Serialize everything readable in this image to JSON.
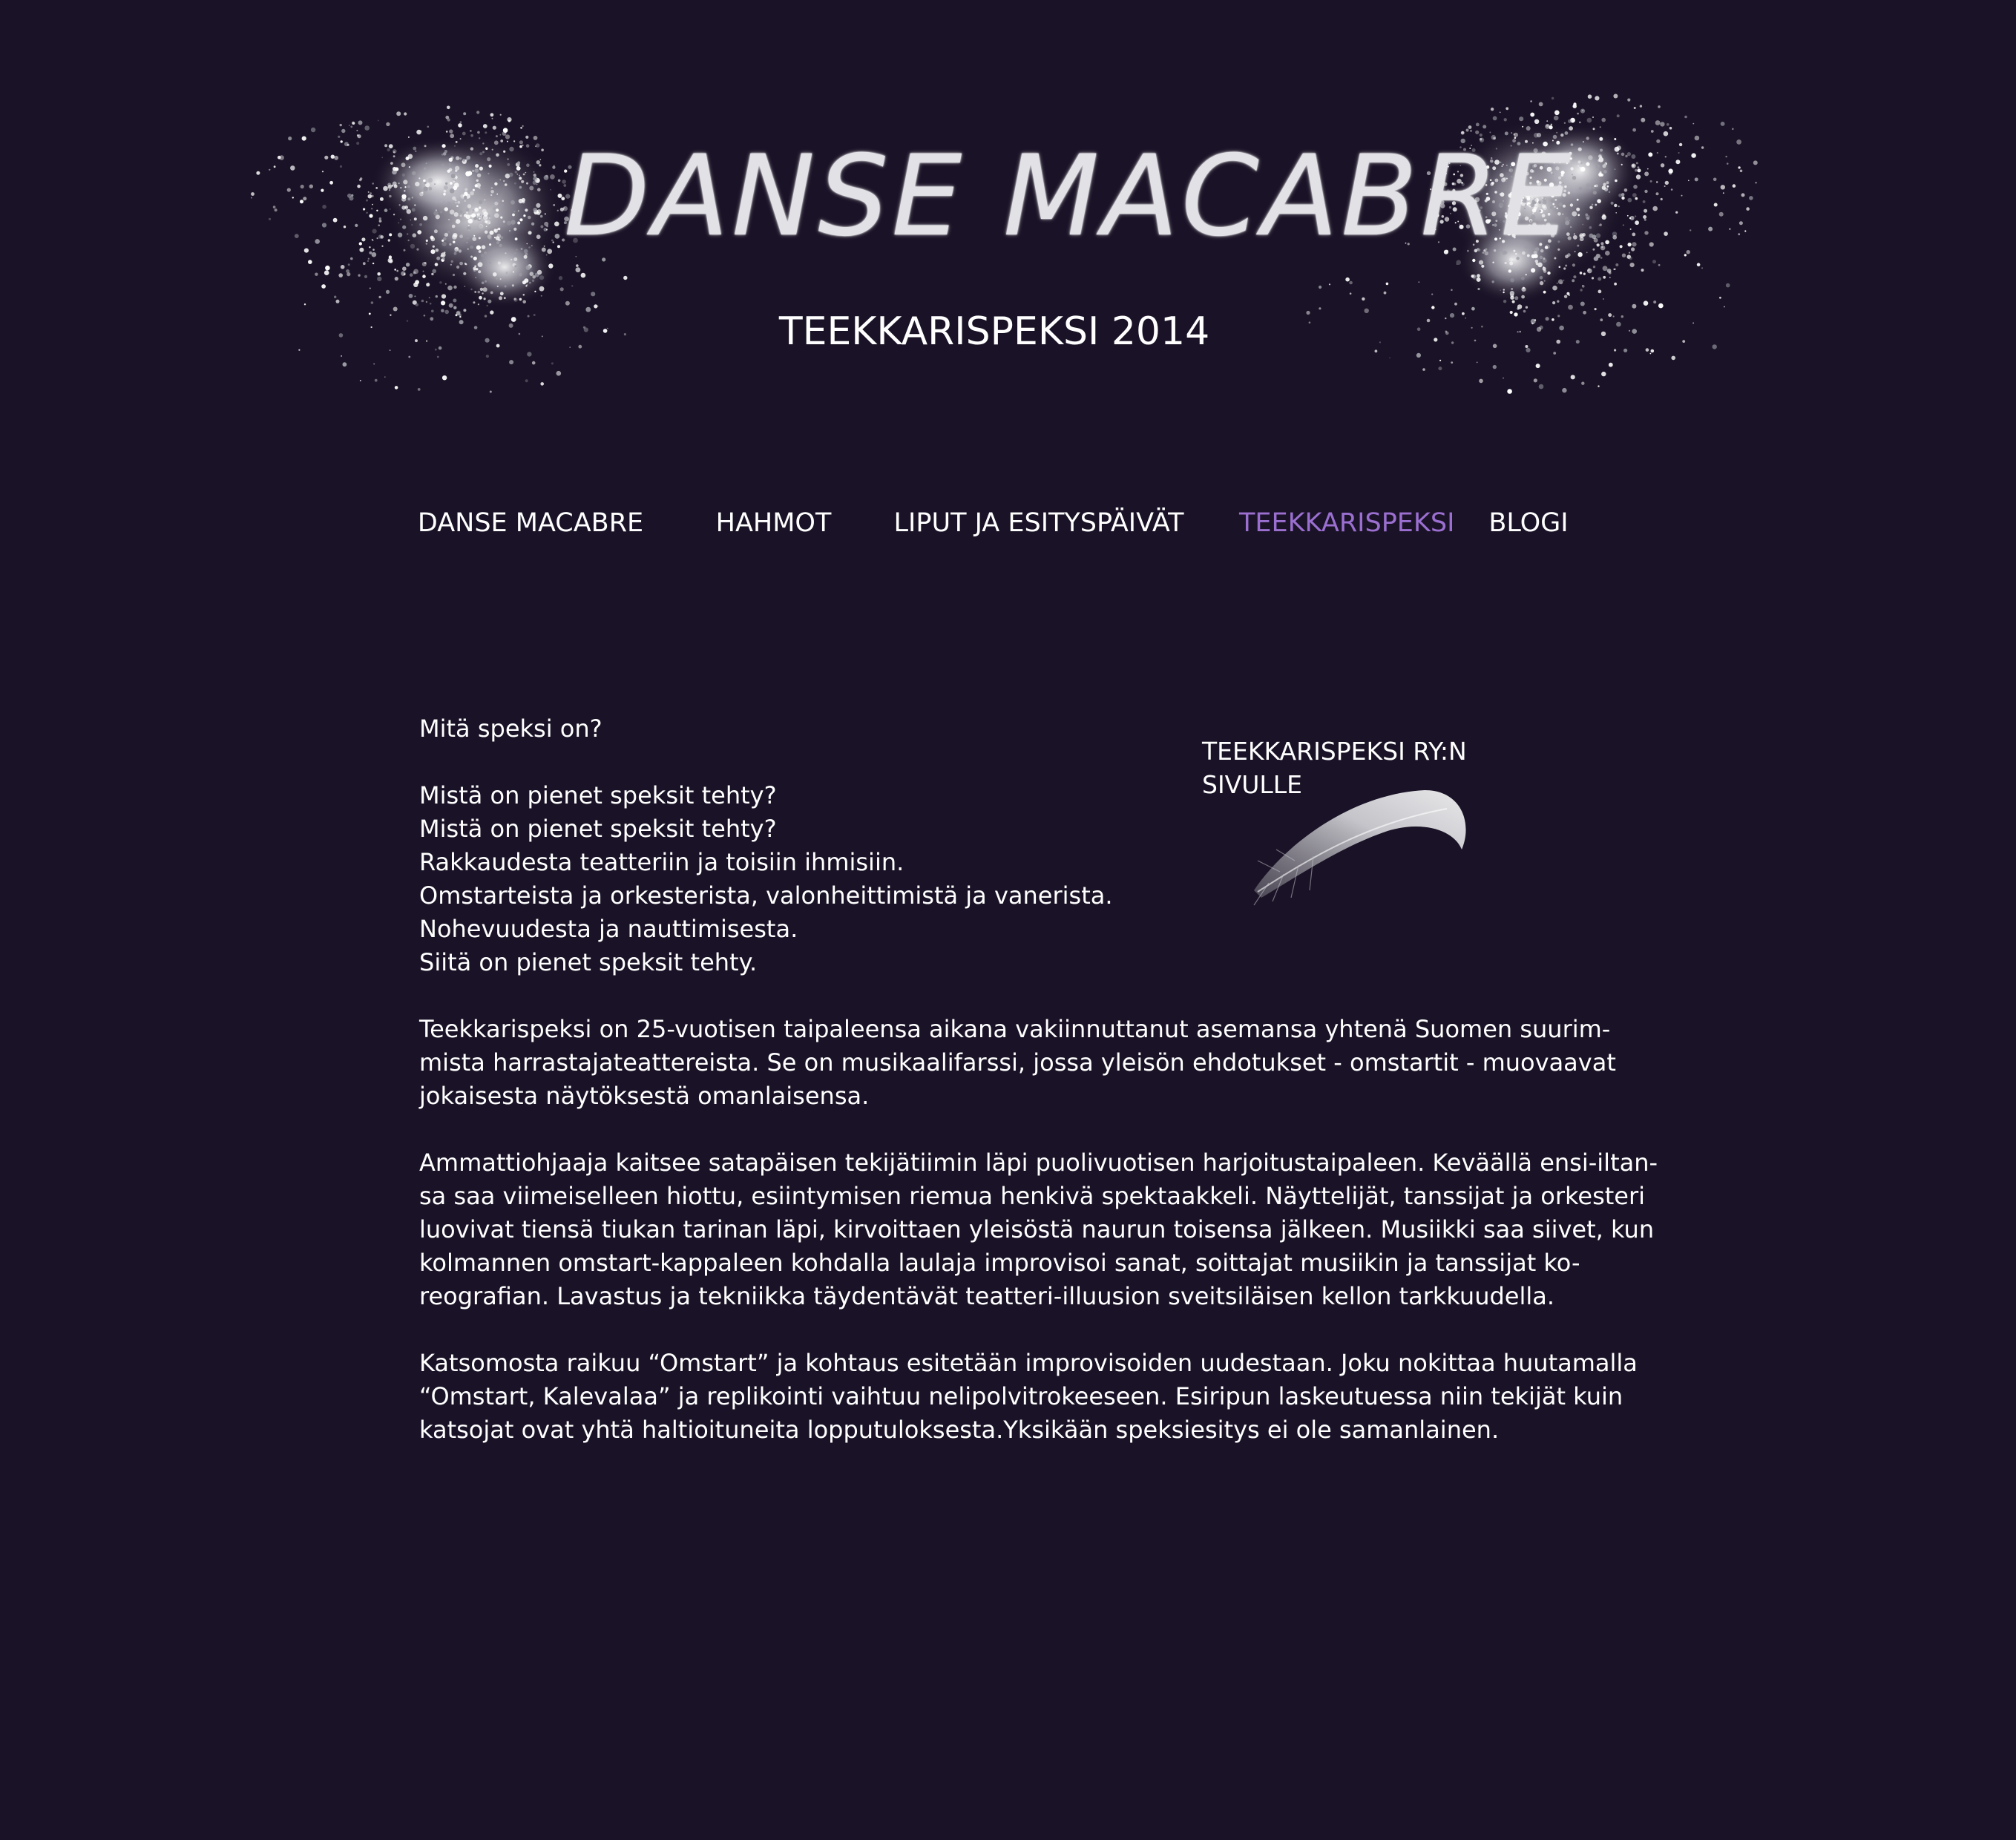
{
  "header": {
    "title": "DANSE MACABRE",
    "subtitle": "TEEKKARISPEKSI 2014"
  },
  "nav": {
    "items": [
      {
        "label": "DANSE MACABRE",
        "active": false
      },
      {
        "label": "HAHMOT",
        "active": false
      },
      {
        "label": "LIPUT JA ESITYSPÄIVÄT",
        "active": false
      },
      {
        "label": "TEEKKARISPEKSI",
        "active": true
      },
      {
        "label": "BLOGI",
        "active": false
      }
    ],
    "active_color": "#9a6fd0",
    "text_color": "#ffffff"
  },
  "content": {
    "heading": "Mitä speksi on?",
    "poem": [
      "Mistä on pienet speksit tehty?",
      "Mistä on pienet speksit tehty?",
      "Rakkaudesta teatteriin ja toisiin ihmisiin.",
      "Omstarteista ja orkesterista, valonheittimistä ja vanerista.",
      "Nohevuudesta ja nauttimisesta.",
      "Siitä on pienet speksit tehty."
    ],
    "paragraph1": [
      "Teekkarispeksi on 25-vuotisen taipaleensa aikana vakiinnuttanut asemansa yhtenä Suomen suurim-",
      "mista harrastajateattereista. Se on musikaalifarssi, jossa yleisön ehdotukset - omstartit - muovaavat",
      "jokaisesta näytöksestä omanlaisensa."
    ],
    "paragraph2": [
      "Ammattiohjaaja kaitsee satapäisen tekijätiimin läpi puolivuotisen harjoitustaipaleen. Keväällä ensi-iltan-",
      "sa saa viimeiselleen hiottu, esiintymisen riemua henkivä spektaakkeli. Näyttelijät, tanssijat ja orkesteri",
      "luovivat tiensä tiukan tarinan läpi, kirvoittaen yleisöstä naurun toisensa jälkeen. Musiikki saa siivet, kun",
      "kolmannen omstart-kappaleen kohdalla laulaja improvisoi sanat, soittajat musiikin ja tanssijat ko-",
      "reografian. Lavastus ja tekniikka täydentävät teatteri-illuusion sveitsiläisen kellon tarkkuudella."
    ],
    "paragraph3": [
      "Katsomosta raikuu “Omstart” ja kohtaus esitetään improvisoiden uudestaan. Joku nokittaa huutamalla",
      "“Omstart, Kalevalaa” ja replikointi vaihtuu nelipolvitrokeeseen. Esiripun laskeutuessa niin tekijät kuin",
      "katsojat ovat yhtä haltioituneita lopputuloksesta.Yksikään speksiesitys ei ole samanlainen."
    ]
  },
  "side_link": {
    "line1": "TEEKKARISPEKSI RY:N",
    "line2": "SIVULLE",
    "icon": "feather-icon"
  },
  "colors": {
    "background": "#1a1226",
    "text": "#ffffff",
    "accent": "#9a6fd0"
  }
}
